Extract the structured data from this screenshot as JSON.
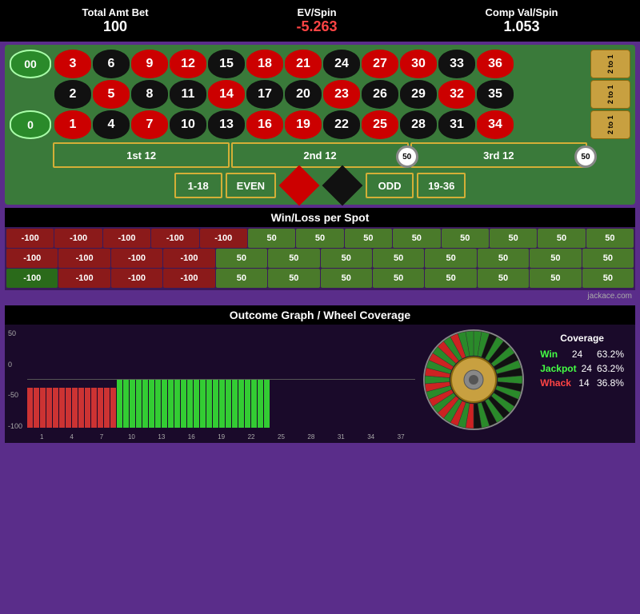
{
  "header": {
    "total_amt_bet_label": "Total Amt Bet",
    "total_amt_bet_value": "100",
    "ev_spin_label": "EV/Spin",
    "ev_spin_value": "-5.263",
    "comp_val_label": "Comp Val/Spin",
    "comp_val_value": "1.053"
  },
  "table": {
    "zeros": [
      "00",
      "0"
    ],
    "two_to_one_labels": [
      "2 to 1",
      "2 to 1",
      "2 to 1"
    ],
    "rows": [
      [
        {
          "n": "3",
          "c": "red"
        },
        {
          "n": "6",
          "c": "black"
        },
        {
          "n": "9",
          "c": "red"
        },
        {
          "n": "12",
          "c": "red"
        },
        {
          "n": "15",
          "c": "black"
        },
        {
          "n": "18",
          "c": "red"
        },
        {
          "n": "21",
          "c": "red"
        },
        {
          "n": "24",
          "c": "black"
        },
        {
          "n": "27",
          "c": "red"
        },
        {
          "n": "30",
          "c": "red"
        },
        {
          "n": "33",
          "c": "black"
        },
        {
          "n": "36",
          "c": "red"
        }
      ],
      [
        {
          "n": "2",
          "c": "black"
        },
        {
          "n": "5",
          "c": "red"
        },
        {
          "n": "8",
          "c": "black"
        },
        {
          "n": "11",
          "c": "black"
        },
        {
          "n": "14",
          "c": "red"
        },
        {
          "n": "17",
          "c": "black"
        },
        {
          "n": "20",
          "c": "black"
        },
        {
          "n": "23",
          "c": "red"
        },
        {
          "n": "26",
          "c": "black"
        },
        {
          "n": "29",
          "c": "black"
        },
        {
          "n": "32",
          "c": "red"
        },
        {
          "n": "35",
          "c": "black"
        }
      ],
      [
        {
          "n": "1",
          "c": "red"
        },
        {
          "n": "4",
          "c": "black"
        },
        {
          "n": "7",
          "c": "red"
        },
        {
          "n": "10",
          "c": "black"
        },
        {
          "n": "13",
          "c": "black"
        },
        {
          "n": "16",
          "c": "red"
        },
        {
          "n": "19",
          "c": "red"
        },
        {
          "n": "22",
          "c": "black"
        },
        {
          "n": "25",
          "c": "red"
        },
        {
          "n": "28",
          "c": "black"
        },
        {
          "n": "31",
          "c": "black"
        },
        {
          "n": "34",
          "c": "red"
        }
      ]
    ],
    "dozen_labels": [
      "1st 12",
      "2nd 12",
      "3rd 12"
    ],
    "outside_bets": [
      "1-18",
      "EVEN",
      "ODD",
      "19-36"
    ],
    "chip_value": "50"
  },
  "winloss": {
    "title": "Win/Loss per Spot",
    "rows": [
      [
        "-100",
        "-100",
        "-100",
        "-100",
        "-100",
        "50",
        "50",
        "50",
        "50",
        "50",
        "50",
        "50",
        "50"
      ],
      [
        "-100",
        "-100",
        "-100",
        "-100",
        "50",
        "50",
        "50",
        "50",
        "50",
        "50",
        "50",
        "50"
      ],
      [
        "-100",
        "-100",
        "-100",
        "-100",
        "50",
        "50",
        "50",
        "50",
        "50",
        "50",
        "50",
        "50"
      ]
    ],
    "attribution": "jackace.com"
  },
  "graph": {
    "title": "Outcome Graph / Wheel Coverage",
    "y_labels": [
      "50",
      "0",
      "-50",
      "-100"
    ],
    "x_labels": [
      "1",
      "4",
      "7",
      "10",
      "13",
      "16",
      "19",
      "22",
      "25",
      "28",
      "31",
      "34",
      "37"
    ],
    "red_bars_count": 14,
    "green_bars_count": 24,
    "coverage": {
      "title": "Coverage",
      "win_label": "Win",
      "win_count": "24",
      "win_pct": "63.2%",
      "jackpot_label": "Jackpot",
      "jackpot_count": "24",
      "jackpot_pct": "63.2%",
      "whack_label": "Whack",
      "whack_count": "14",
      "whack_pct": "36.8%"
    }
  }
}
